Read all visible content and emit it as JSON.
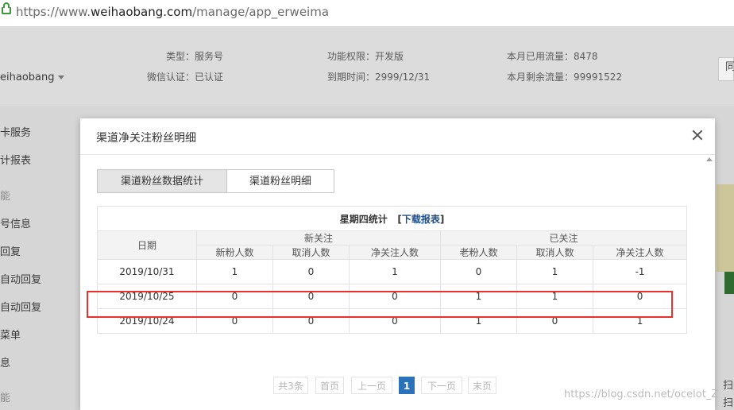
{
  "browser": {
    "url_prefix": "https://www.",
    "url_domain": "weihaobang.com",
    "url_path": "/manage/app_erweima"
  },
  "background": {
    "brand": "eihaobang",
    "info": {
      "type_label": "类型：服务号",
      "auth_label": "微信认证：已认证",
      "perm_label": "功能权限：开发版",
      "expire_label": "到期时间：2999/12/31",
      "used_label": "本月已用流量：8478",
      "remain_label": "本月剩余流量：99991522"
    },
    "sidebar": [
      "卡服务",
      "计报表",
      "能",
      "号信息",
      "回复",
      "自动回复",
      "自动回复",
      "菜单",
      "息",
      "能"
    ],
    "right_button": "同",
    "right_texts": [
      "扫",
      "扫"
    ]
  },
  "modal": {
    "title": "渠道净关注粉丝明细",
    "tabs": [
      "渠道粉丝数据统计",
      "渠道粉丝明细"
    ],
    "table": {
      "caption": "星期四统计",
      "download_link": "下载报表",
      "date_header": "日期",
      "group_new": "新关注",
      "group_followed": "已关注",
      "columns": [
        "新粉人数",
        "取消人数",
        "净关注人数",
        "老粉人数",
        "取消人数",
        "净关注人数"
      ],
      "rows": [
        {
          "date": "2019/10/31",
          "values": [
            "1",
            "0",
            "1",
            "0",
            "1",
            "-1"
          ]
        },
        {
          "date": "2019/10/25",
          "values": [
            "0",
            "0",
            "0",
            "1",
            "1",
            "0"
          ]
        },
        {
          "date": "2019/10/24",
          "values": [
            "0",
            "0",
            "0",
            "1",
            "0",
            "1"
          ]
        }
      ]
    },
    "pager": {
      "total": "共3条",
      "first": "首页",
      "prev": "上一页",
      "current": "1",
      "next": "下一页",
      "last": "末页"
    }
  },
  "watermark": "https://blog.csdn.net/ocelot_Z",
  "colors": {
    "highlight": "#e8312a",
    "pager_active": "#2b72b8",
    "link": "#1f4f8a"
  }
}
